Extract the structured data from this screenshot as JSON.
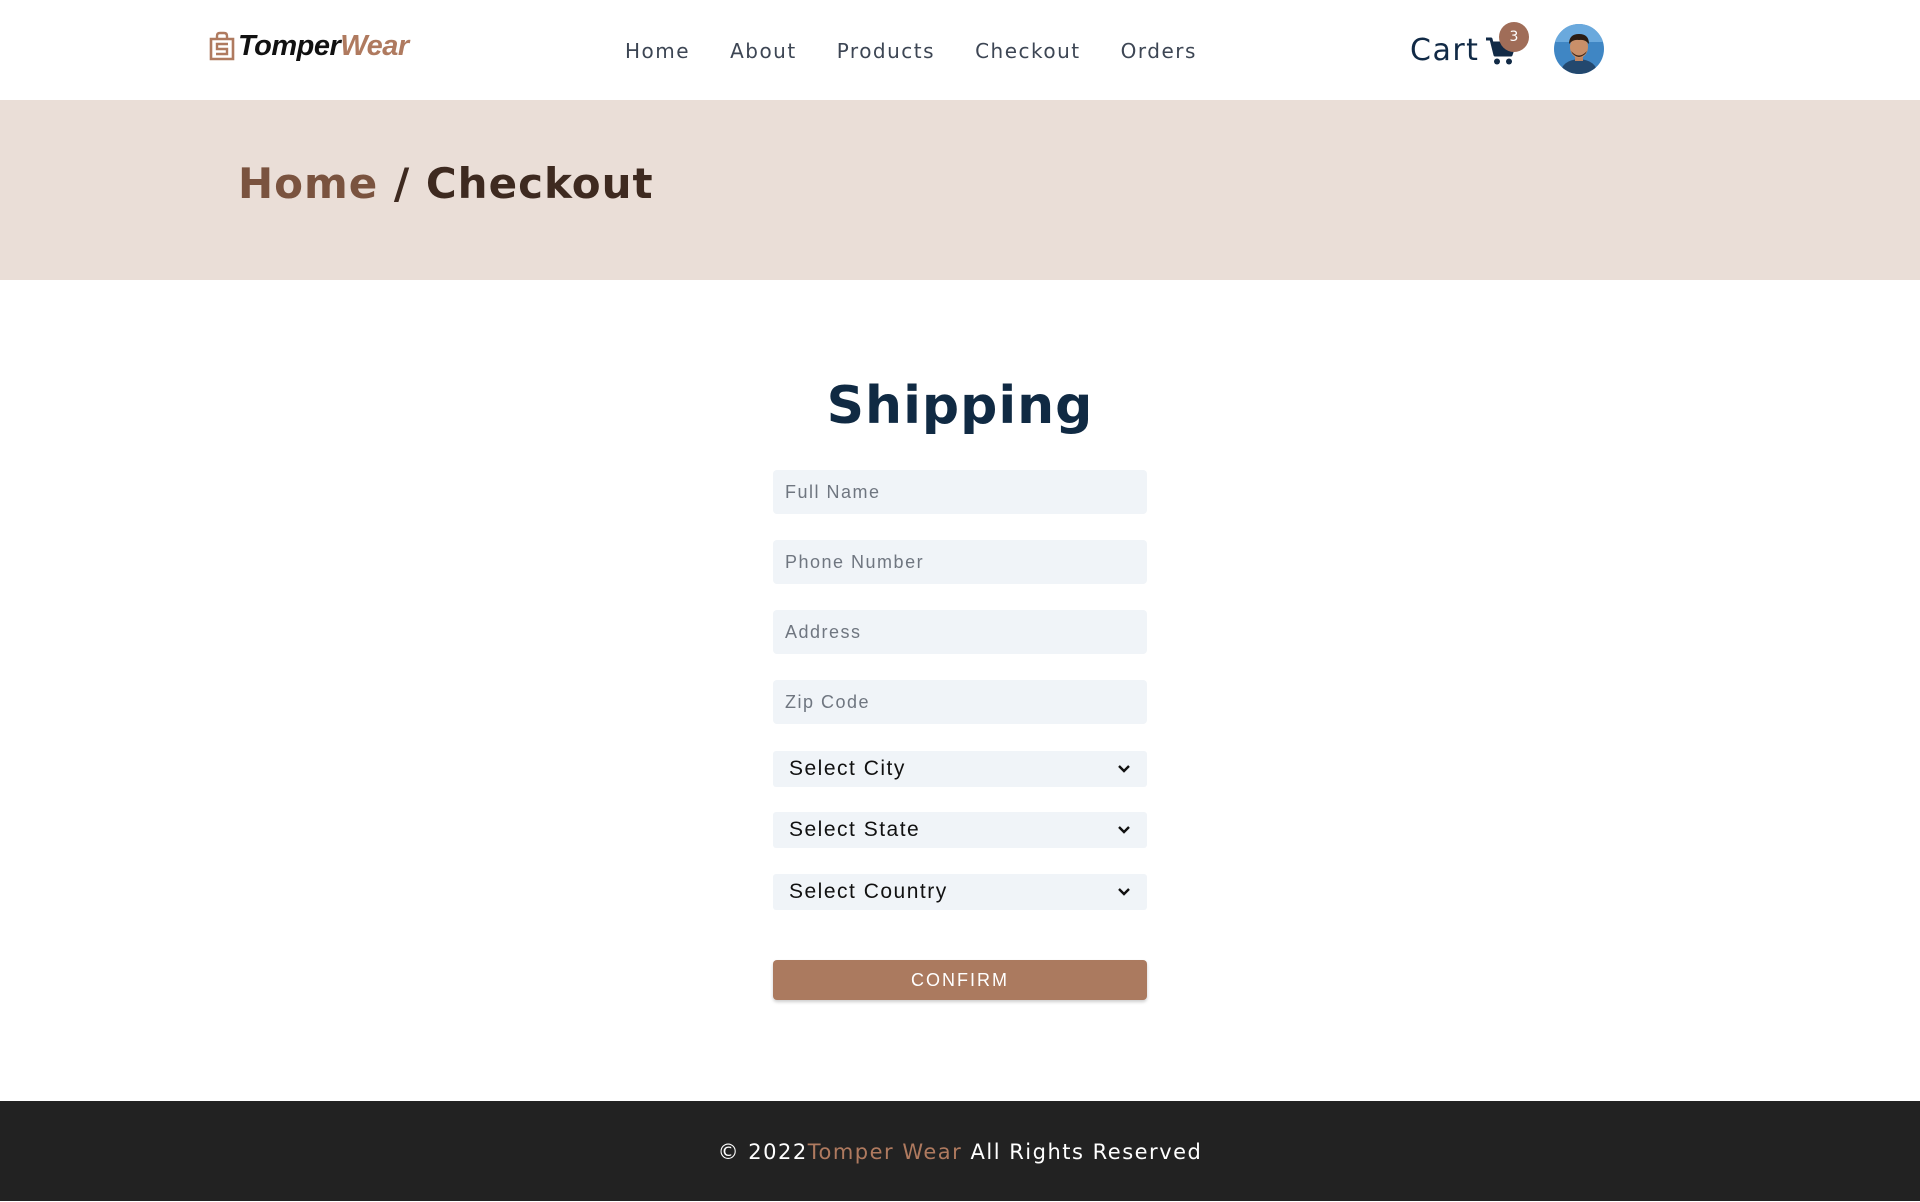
{
  "brand": {
    "name_part1": "Tomper",
    "name_part2": "Wear"
  },
  "nav": {
    "links": [
      {
        "label": "Home"
      },
      {
        "label": "About"
      },
      {
        "label": "Products"
      },
      {
        "label": "Checkout"
      },
      {
        "label": "Orders"
      }
    ],
    "cart_label": "Cart",
    "cart_count": "3",
    "cart_icon": "shopping-cart-icon"
  },
  "breadcrumb": {
    "home": "Home",
    "separator": " / ",
    "current": "Checkout"
  },
  "form": {
    "title": "Shipping",
    "fields": [
      {
        "placeholder": "Full Name",
        "value": ""
      },
      {
        "placeholder": "Phone Number",
        "value": ""
      },
      {
        "placeholder": "Address",
        "value": ""
      },
      {
        "placeholder": "Zip Code",
        "value": ""
      }
    ],
    "selects": [
      {
        "value": "Select City"
      },
      {
        "value": "Select State"
      },
      {
        "value": "Select Country"
      }
    ],
    "confirm_label": "CONFIRM"
  },
  "footer": {
    "copyright": "© 2022",
    "brand": "Tomper Wear",
    "rights": " All Rights Reserved"
  },
  "colors": {
    "accent": "#ab7a5f",
    "hero_bg": "#eaded7",
    "title": "#102a43",
    "field_bg": "#f0f4f8",
    "footer_bg": "#222222"
  }
}
